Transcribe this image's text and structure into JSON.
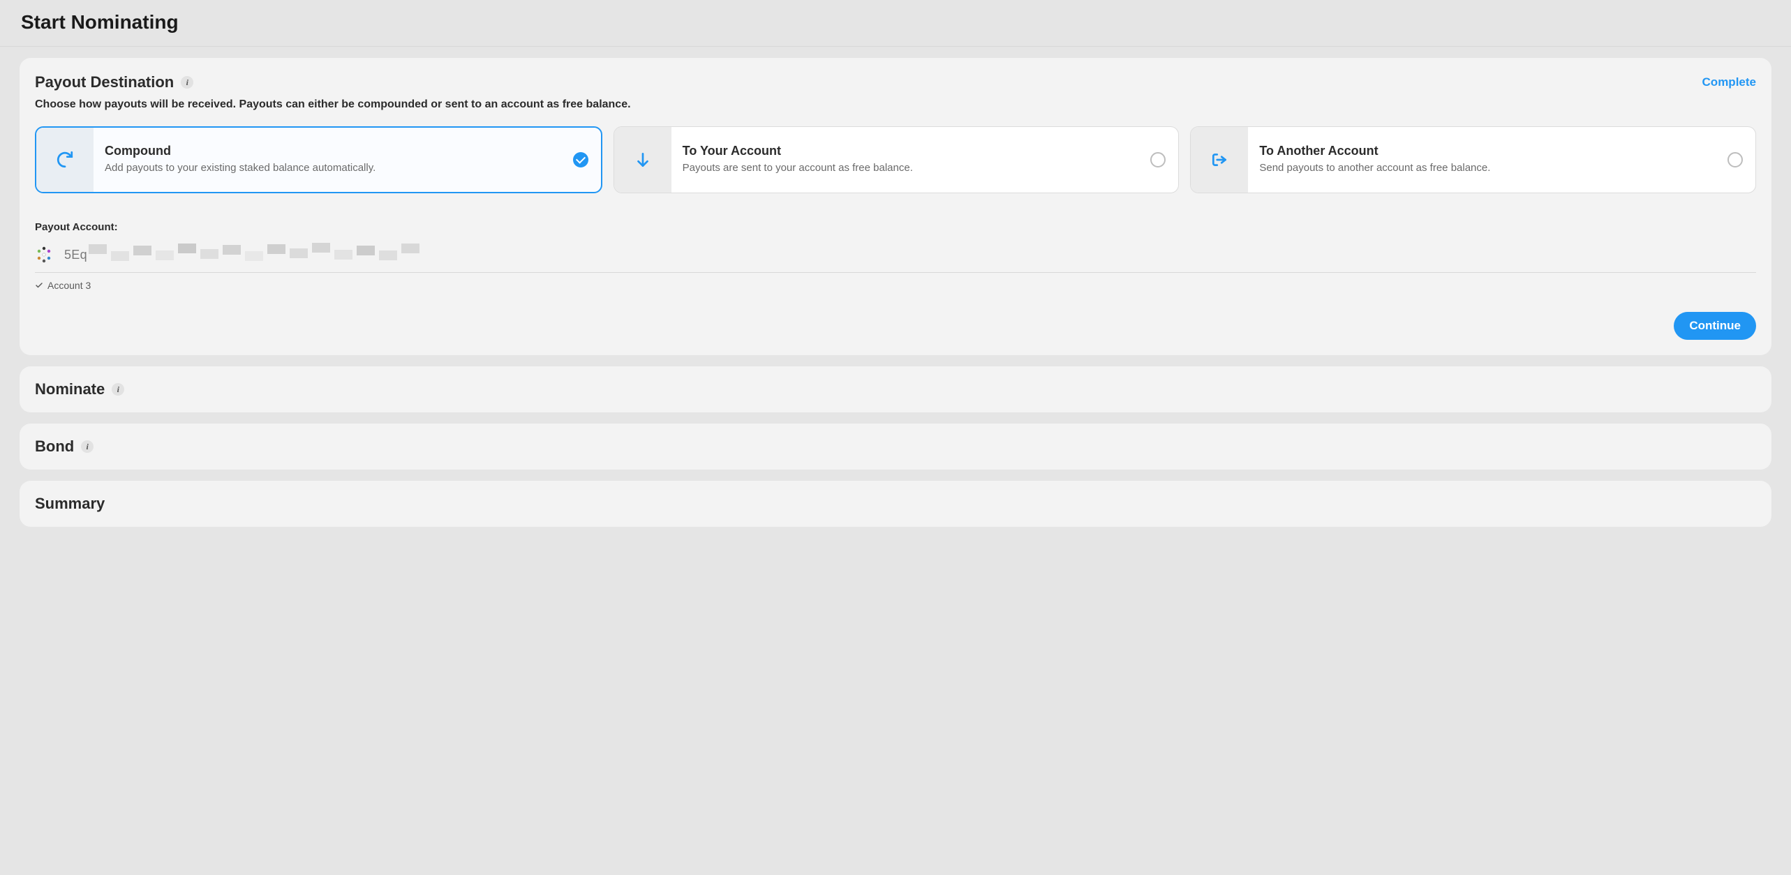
{
  "page": {
    "title": "Start Nominating"
  },
  "payout": {
    "title": "Payout Destination",
    "status": "Complete",
    "subtitle": "Choose how payouts will be received. Payouts can either be compounded or sent to an account as free balance.",
    "options": [
      {
        "title": "Compound",
        "desc": "Add payouts to your existing staked balance automatically.",
        "selected": true
      },
      {
        "title": "To Your Account",
        "desc": "Payouts are sent to your account as free balance.",
        "selected": false
      },
      {
        "title": "To Another Account",
        "desc": "Send payouts to another account as free balance.",
        "selected": false
      }
    ],
    "accountLabel": "Payout Account:",
    "accountAddressPrefix": "5Eq",
    "accountName": "Account 3",
    "continueLabel": "Continue"
  },
  "steps": {
    "nominate": "Nominate",
    "bond": "Bond",
    "summary": "Summary"
  },
  "colors": {
    "accent": "#2196f3"
  }
}
